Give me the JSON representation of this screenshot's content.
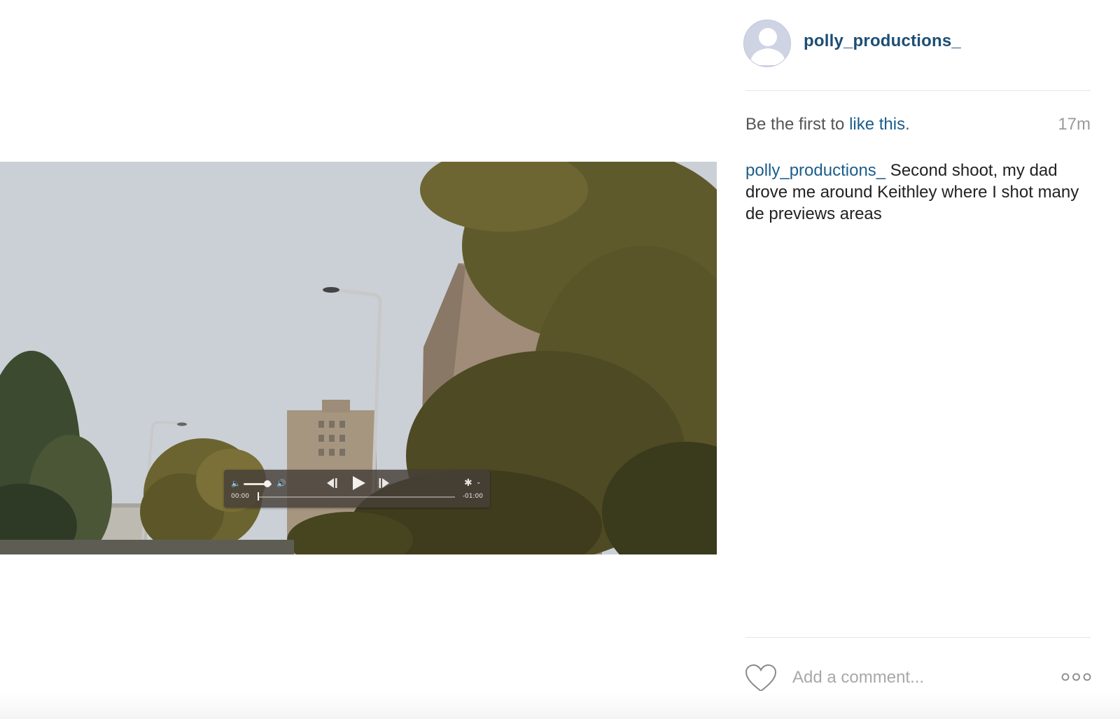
{
  "post": {
    "username": "polly_productions_",
    "likes_prefix": "Be the first to ",
    "likes_link": "like this",
    "likes_suffix": ".",
    "time_ago": "17m",
    "caption_user": "polly_productions_",
    "caption_text": " Second shoot, my dad drove me around Keithley where I shot many de previews areas"
  },
  "video": {
    "current_time": "00:00",
    "remaining_time": "-01:00",
    "progress": 0,
    "volume_level": 0.85
  },
  "comment": {
    "placeholder": "Add a comment..."
  },
  "icons": {
    "avatar": "default-user-avatar",
    "like": "heart-outline-icon",
    "more": "more-options-icon",
    "volume_low": "speaker-low-icon",
    "volume_high": "speaker-high-icon",
    "rewind": "skip-back-icon",
    "play": "play-icon",
    "forward": "skip-forward-icon",
    "settings": "gear-icon"
  },
  "colors": {
    "link": "#1c5d8c",
    "username": "#1c4e74"
  }
}
